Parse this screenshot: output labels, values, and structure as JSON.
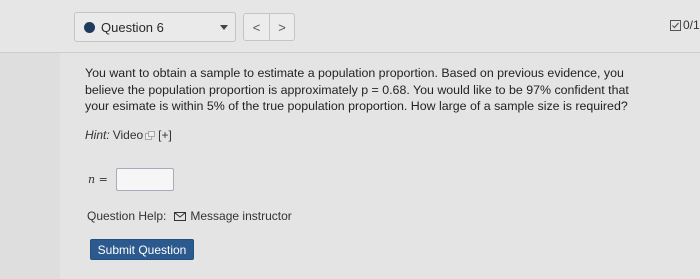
{
  "header": {
    "question_selector": "Question 6",
    "prev_symbol": "<",
    "next_symbol": ">",
    "score": "0/1"
  },
  "question": {
    "text": "You want to obtain a sample to estimate a population proportion. Based on previous evidence, you believe the population proportion is approximately p = 0.68. You would like to be 97% confident that your esimate is within 5% of the true population proportion. How large of a sample size is required?",
    "hint_label": "Hint:",
    "hint_link": "Video",
    "hint_expand": "[+]"
  },
  "answer": {
    "label": "n =",
    "value": ""
  },
  "help": {
    "label": "Question Help:",
    "message_link": "Message instructor"
  },
  "submit_label": "Submit Question",
  "colors": {
    "accent": "#2c5a8e",
    "status_dot": "#1f3b5c",
    "background": "#dedede"
  },
  "icons": [
    "dropdown-caret-icon",
    "external-link-icon",
    "score-checkbox-icon",
    "envelope-icon"
  ]
}
